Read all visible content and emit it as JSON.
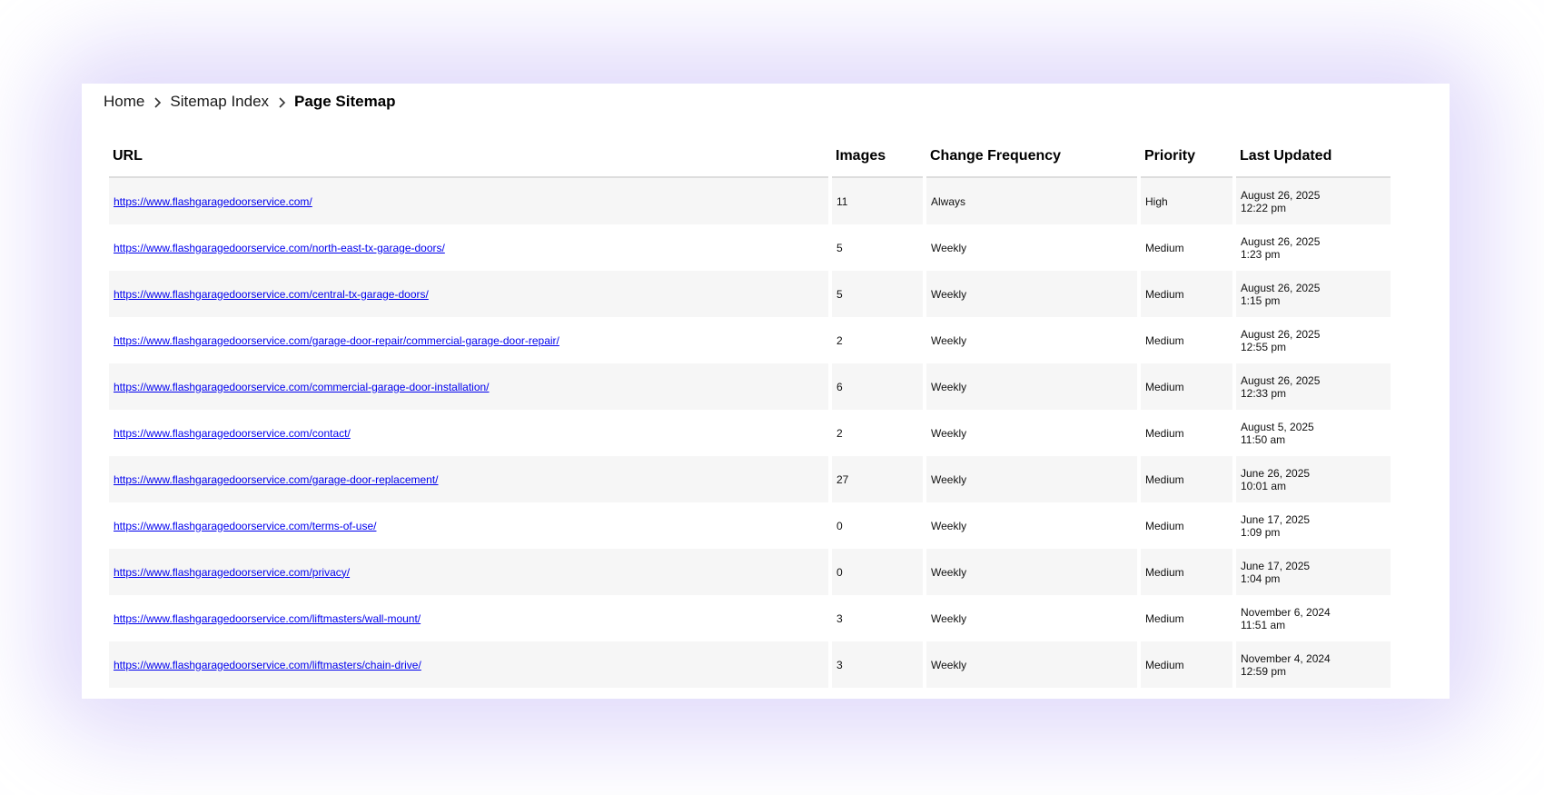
{
  "breadcrumb": {
    "home": "Home",
    "index": "Sitemap Index",
    "current": "Page Sitemap"
  },
  "table": {
    "headers": {
      "url": "URL",
      "images": "Images",
      "frequency": "Change Frequency",
      "priority": "Priority",
      "updated": "Last Updated"
    },
    "rows": [
      {
        "url": "https://www.flashgaragedoorservice.com/",
        "images": "11",
        "frequency": "Always",
        "priority": "High",
        "date": "August 26, 2025",
        "time": "12:22 pm"
      },
      {
        "url": "https://www.flashgaragedoorservice.com/north-east-tx-garage-doors/",
        "images": "5",
        "frequency": "Weekly",
        "priority": "Medium",
        "date": "August 26, 2025",
        "time": "1:23 pm"
      },
      {
        "url": "https://www.flashgaragedoorservice.com/central-tx-garage-doors/",
        "images": "5",
        "frequency": "Weekly",
        "priority": "Medium",
        "date": "August 26, 2025",
        "time": "1:15 pm"
      },
      {
        "url": "https://www.flashgaragedoorservice.com/garage-door-repair/commercial-garage-door-repair/",
        "images": "2",
        "frequency": "Weekly",
        "priority": "Medium",
        "date": "August 26, 2025",
        "time": "12:55 pm"
      },
      {
        "url": "https://www.flashgaragedoorservice.com/commercial-garage-door-installation/",
        "images": "6",
        "frequency": "Weekly",
        "priority": "Medium",
        "date": "August 26, 2025",
        "time": "12:33 pm"
      },
      {
        "url": "https://www.flashgaragedoorservice.com/contact/",
        "images": "2",
        "frequency": "Weekly",
        "priority": "Medium",
        "date": "August 5, 2025",
        "time": "11:50 am"
      },
      {
        "url": "https://www.flashgaragedoorservice.com/garage-door-replacement/",
        "images": "27",
        "frequency": "Weekly",
        "priority": "Medium",
        "date": "June 26, 2025",
        "time": "10:01 am"
      },
      {
        "url": "https://www.flashgaragedoorservice.com/terms-of-use/",
        "images": "0",
        "frequency": "Weekly",
        "priority": "Medium",
        "date": "June 17, 2025",
        "time": "1:09 pm"
      },
      {
        "url": "https://www.flashgaragedoorservice.com/privacy/",
        "images": "0",
        "frequency": "Weekly",
        "priority": "Medium",
        "date": "June 17, 2025",
        "time": "1:04 pm"
      },
      {
        "url": "https://www.flashgaragedoorservice.com/liftmasters/wall-mount/",
        "images": "3",
        "frequency": "Weekly",
        "priority": "Medium",
        "date": "November 6, 2024",
        "time": "11:51 am"
      },
      {
        "url": "https://www.flashgaragedoorservice.com/liftmasters/chain-drive/",
        "images": "3",
        "frequency": "Weekly",
        "priority": "Medium",
        "date": "November 4, 2024",
        "time": "12:59 pm"
      }
    ]
  },
  "icons": {
    "separator": "chevron-right-icon"
  },
  "colors": {
    "link": "#0000ee",
    "row_shade": "#f6f6f6",
    "glow": "#cec4f8"
  }
}
